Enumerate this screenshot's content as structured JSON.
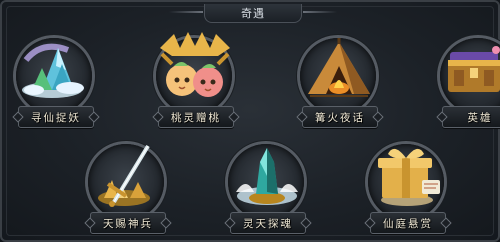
{
  "window": {
    "title": "奇遇"
  },
  "events": [
    {
      "id": "scene-1",
      "label": "寻仙捉妖",
      "icon": "ice-mountain-icon"
    },
    {
      "id": "scene-2",
      "label": "桃灵赠桃",
      "icon": "peach-spirits-icon"
    },
    {
      "id": "scene-3",
      "label": "篝火夜话",
      "icon": "campfire-tent-icon"
    },
    {
      "id": "scene-4",
      "label": "英雄",
      "icon": "treasure-chest-icon"
    },
    {
      "id": "scene-5",
      "label": "天赐神兵",
      "icon": "sword-gold-icon"
    },
    {
      "id": "scene-6",
      "label": "灵天探魂",
      "icon": "crystal-orb-icon"
    },
    {
      "id": "scene-7",
      "label": "仙庭悬赏",
      "icon": "gift-box-icon"
    }
  ],
  "colors": {
    "gold": "#e8b54a",
    "ice": "#7fd4e8",
    "peach": "#f2a25a",
    "fire": "#ff9a2a",
    "crystal": "#4fd0c8"
  }
}
